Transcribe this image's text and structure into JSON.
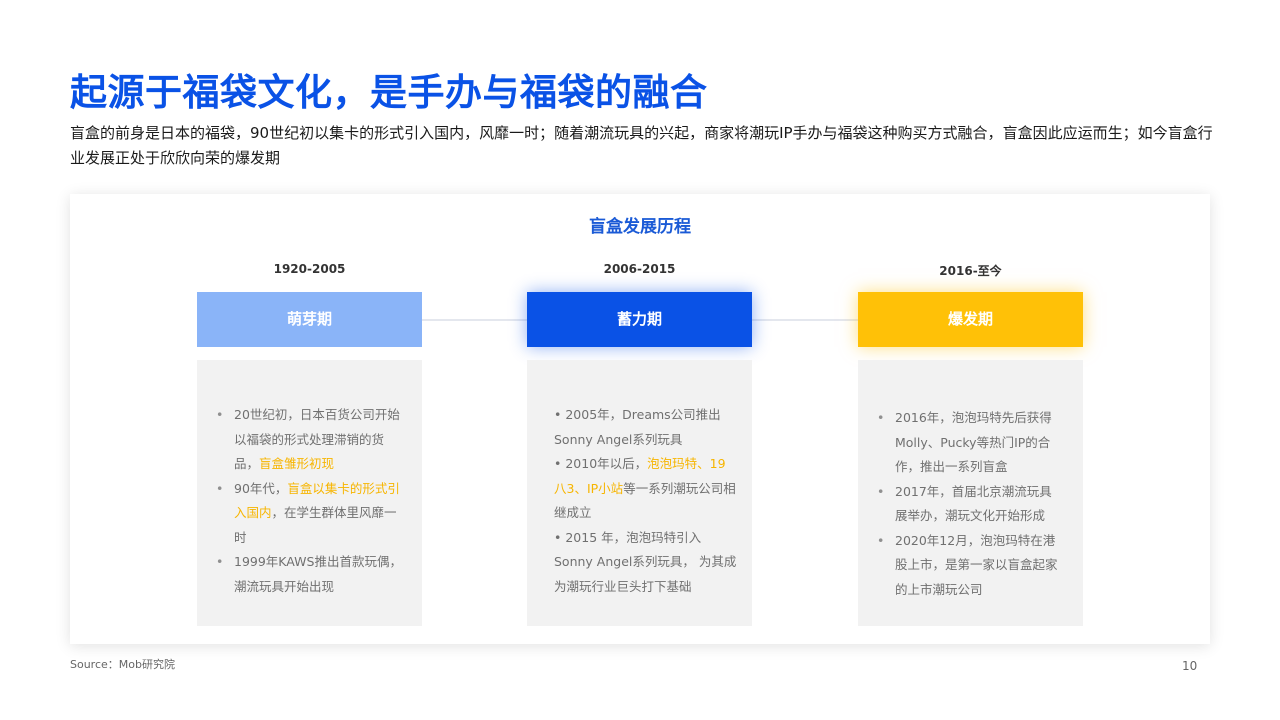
{
  "header": {
    "title": "起源于福袋文化，是手办与福袋的融合",
    "subtitle": "盲盒的前身是日本的福袋，90世纪初以集卡的形式引入国内，风靡一时；随着潮流玩具的兴起，商家将潮玩IP手办与福袋这种购买方式融合，盲盒因此应运而生；如今盲盒行业发展正处于欣欣向荣的爆发期"
  },
  "timeline": {
    "title": "盲盒发展历程",
    "stages": [
      {
        "year": "1920-2005",
        "phase": "萌芽期",
        "color": "#8ab4f8",
        "items": [
          {
            "pre": "20世纪初，日本百货公司开始以福袋的形式处理滞销的货品，",
            "hl": "盲盒雏形初现",
            "post": ""
          },
          {
            "pre": "90年代，",
            "hl": "盲盒以集卡的形式引入国内",
            "post": "，在学生群体里风靡一时"
          },
          {
            "pre": "1999年KAWS推出首款玩偶，潮流玩具开始出现",
            "hl": "",
            "post": ""
          }
        ]
      },
      {
        "year": "2006-2015",
        "phase": "蓄力期",
        "color": "#0a52e6",
        "items": [
          {
            "pre": "• 2005年，Dreams公司推出Sonny Angel系列玩具",
            "hl": "",
            "post": ""
          },
          {
            "pre": "• 2010年以后，",
            "hl": "泡泡玛特、19八3、IP小站",
            "post": "等一系列潮玩公司相继成立"
          },
          {
            "pre": " • 2015 年，泡泡玛特引入Sonny Angel系列玩具， 为其成为潮玩行业巨头打下基础",
            "hl": "",
            "post": ""
          }
        ]
      },
      {
        "year": "2016-至今",
        "phase": "爆发期",
        "color": "#ffc107",
        "items": [
          {
            "pre": "2016年，泡泡玛特先后获得Molly、Pucky等热门IP的合作，推出一系列盲盒",
            "hl": "",
            "post": ""
          },
          {
            "pre": "2017年，首届北京潮流玩具展举办，潮玩文化开始形成",
            "hl": "",
            "post": ""
          },
          {
            "pre": "2020年12月，泡泡玛特在港股上市，是第一家以盲盒起家的上市潮玩公司",
            "hl": "",
            "post": ""
          }
        ]
      }
    ]
  },
  "footer": {
    "source": "Source：Mob研究院",
    "page_number": "10"
  }
}
